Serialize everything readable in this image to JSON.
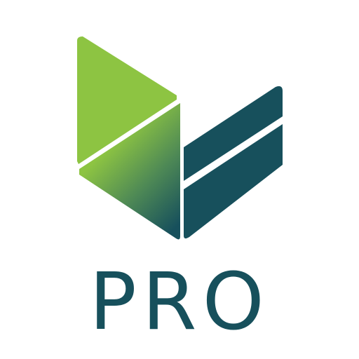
{
  "logo": {
    "wordmark": "PRO",
    "colors": {
      "green": "#8dc442",
      "teal": "#17505c",
      "background": "#ffffff"
    }
  }
}
